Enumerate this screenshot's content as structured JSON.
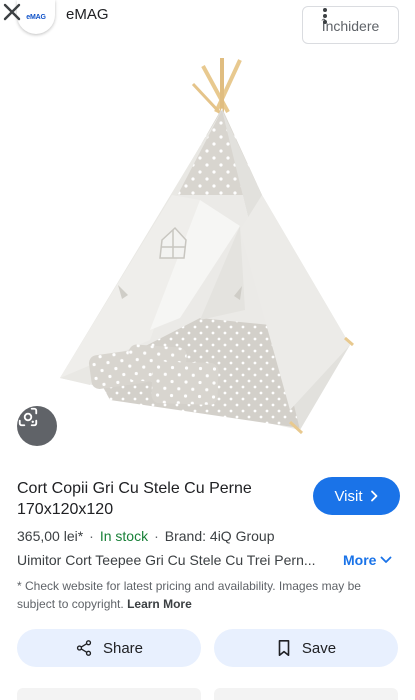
{
  "header": {
    "source_logo_text": "eMAG",
    "source_name": "eMAG",
    "close_label": "Închidere"
  },
  "product": {
    "title": "Cort Copii Gri Cu Stele Cu Perne 170x120x120",
    "price": "365,00 lei*",
    "stock": "In stock",
    "brand": "Brand: 4iQ Group",
    "description": "Uimitor Cort Teepee Gri Cu Stele Cu Trei Pern...",
    "more_label": "More",
    "note": "* Check website for latest pricing and availability. Images may be subject to copyright.",
    "learn_more": "Learn More"
  },
  "actions": {
    "visit_label": "Visit",
    "share_label": "Share",
    "save_label": "Save"
  },
  "colors": {
    "accent": "#1a73e8",
    "stock": "#188038",
    "action_bg": "#e8f0fe"
  },
  "icons": [
    "more-vert-icon",
    "close-icon",
    "lens-icon",
    "chevron-right-icon",
    "chevron-down-icon",
    "share-icon",
    "bookmark-icon"
  ]
}
